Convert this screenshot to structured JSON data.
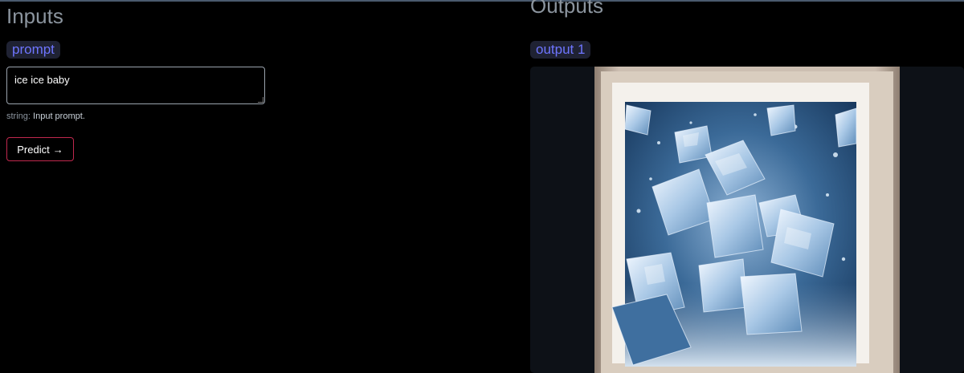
{
  "inputs": {
    "title": "Inputs",
    "prompt_label": "prompt",
    "prompt_value": "ice ice baby",
    "hint_type": "string:",
    "hint_desc": "Input prompt.",
    "predict_label": "Predict",
    "predict_icon": "right-arrow-icon",
    "predict_arrow": "→"
  },
  "outputs": {
    "title": "Outputs",
    "output_label": "output 1",
    "image_subject": "framed image of ice cubes"
  },
  "colors": {
    "background": "#000000",
    "pill_bg": "#1f2233",
    "pill_text": "#6e75ff",
    "predict_border": "#c0284e",
    "card_bg": "#0d1117"
  }
}
